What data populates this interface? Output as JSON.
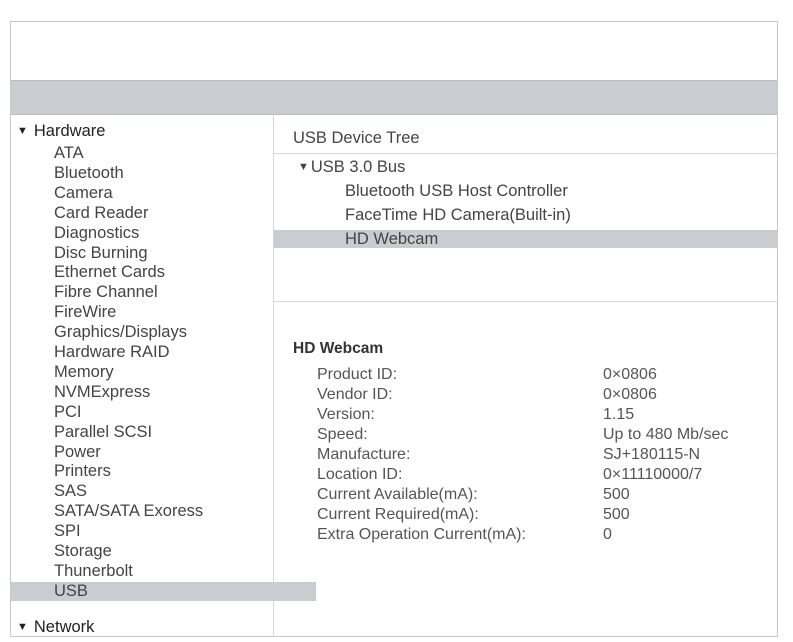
{
  "sidebar": {
    "hardware_label": "Hardware",
    "items": [
      "ATA",
      "Bluetooth",
      "Camera",
      "Card Reader",
      "Diagnostics",
      "Disc Burning",
      "Ethernet Cards",
      "Fibre Channel",
      "FireWire",
      "Graphics/Displays",
      "Hardware RAID",
      "Memory",
      "NVMExpress",
      "PCI",
      "Parallel SCSI",
      "Power",
      "Printers",
      "SAS",
      "SATA/SATA Exoress",
      "SPI",
      "Storage",
      "Thunerbolt",
      "USB"
    ],
    "selected": "USB",
    "network_label": "Network"
  },
  "tree": {
    "title": "USB Device Tree",
    "bus": "USB 3.0 Bus",
    "devices": [
      "Bluetooth USB Host Controller",
      "FaceTime HD Camera(Built-in)",
      "HD Webcam"
    ],
    "selected": "HD Webcam"
  },
  "details": {
    "title": "HD Webcam",
    "props": [
      {
        "label": "Product ID:",
        "value": "0×0806"
      },
      {
        "label": "Vendor ID:",
        "value": "0×0806"
      },
      {
        "label": "Version:",
        "value": "1.15"
      },
      {
        "label": "Speed:",
        "value": "Up to 480 Mb/sec"
      },
      {
        "label": "Manufacture:",
        "value": "SJ+180115-N"
      },
      {
        "label": "Location ID:",
        "value": "0×11110000/7"
      },
      {
        "label": "Current Available(mA):",
        "value": "500"
      },
      {
        "label": "Current Required(mA):",
        "value": "500"
      },
      {
        "label": "Extra Operation Current(mA):",
        "value": "0"
      }
    ]
  }
}
